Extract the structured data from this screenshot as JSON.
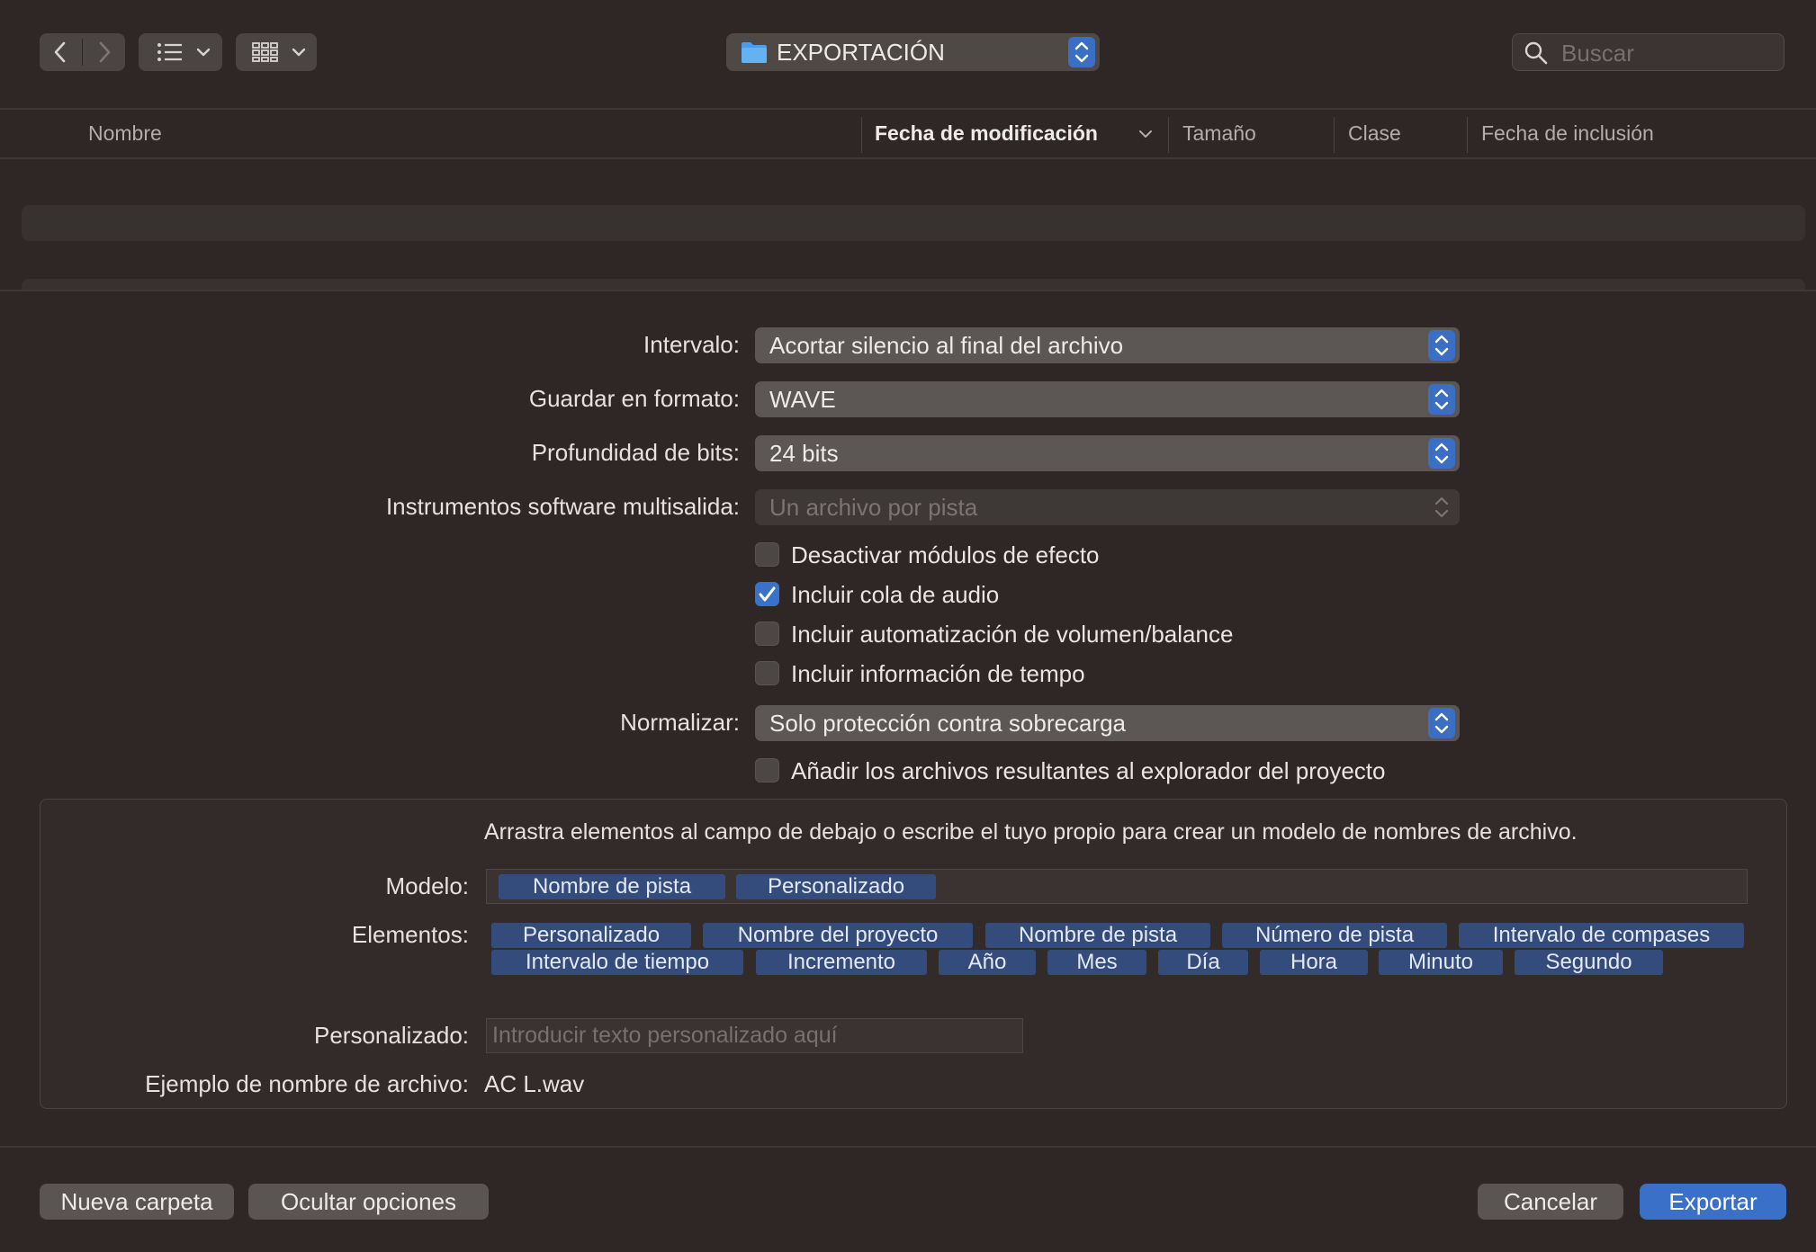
{
  "toolbar": {
    "location": "EXPORTACIÓN",
    "search_placeholder": "Buscar"
  },
  "columns": [
    {
      "label": "Nombre"
    },
    {
      "label": "Fecha de modificación"
    },
    {
      "label": "Tamaño"
    },
    {
      "label": "Clase"
    },
    {
      "label": "Fecha de inclusión"
    }
  ],
  "options": {
    "interval": {
      "label": "Intervalo:",
      "value": "Acortar silencio al final del archivo"
    },
    "format": {
      "label": "Guardar en formato:",
      "value": "WAVE"
    },
    "bit_depth": {
      "label": "Profundidad de bits:",
      "value": "24 bits"
    },
    "multi_output": {
      "label": "Instrumentos software multisalida:",
      "value": "Un archivo por pista"
    },
    "checkboxes": [
      {
        "label": "Desactivar módulos de efecto",
        "checked": false
      },
      {
        "label": "Incluir cola de audio",
        "checked": true
      },
      {
        "label": "Incluir automatización de volumen/balance",
        "checked": false
      },
      {
        "label": "Incluir información de tempo",
        "checked": false
      }
    ],
    "normalize": {
      "label": "Normalizar:",
      "value": "Solo protección contra sobrecarga"
    },
    "add_to_browser": {
      "label": "Añadir los archivos resultantes al explorador del proyecto",
      "checked": false
    }
  },
  "naming": {
    "instructions": "Arrastra elementos al campo de debajo o escribe el tuyo propio para crear un modelo de nombres de archivo.",
    "model_label": "Modelo:",
    "model_tokens": [
      "Nombre de pista",
      "Personalizado"
    ],
    "elements_label": "Elementos:",
    "elements": [
      "Personalizado",
      "Nombre del proyecto",
      "Nombre de pista",
      "Número de pista",
      "Intervalo de compases",
      "Intervalo de tiempo",
      "Incremento",
      "Año",
      "Mes",
      "Día",
      "Hora",
      "Minuto",
      "Segundo"
    ],
    "custom_label": "Personalizado:",
    "custom_placeholder": "Introducir texto personalizado aquí",
    "example_label": "Ejemplo de nombre de archivo:",
    "example_value": "AC L.wav"
  },
  "buttons": {
    "new_folder": "Nueva carpeta",
    "hide_options": "Ocultar opciones",
    "cancel": "Cancelar",
    "export": "Exportar"
  }
}
